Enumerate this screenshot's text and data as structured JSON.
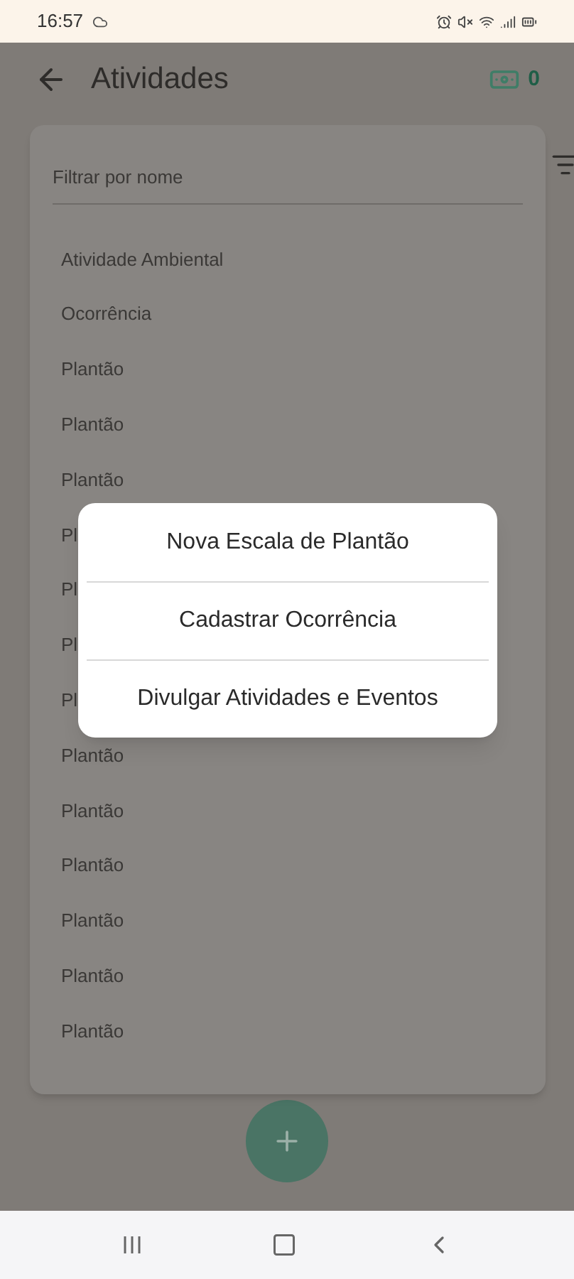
{
  "status_bar": {
    "time": "16:57"
  },
  "app_bar": {
    "title": "Atividades",
    "counter": "0"
  },
  "filter": {
    "placeholder": "Filtrar por nome"
  },
  "items": [
    {
      "label": "Atividade Ambiental"
    },
    {
      "label": "Ocorrência"
    },
    {
      "label": "Plantão"
    },
    {
      "label": "Plantão"
    },
    {
      "label": "Plantão"
    },
    {
      "label": "Pl"
    },
    {
      "label": "Pl"
    },
    {
      "label": "Pl"
    },
    {
      "label": "Pl"
    },
    {
      "label": "Plantão"
    },
    {
      "label": "Plantão"
    },
    {
      "label": "Plantão"
    },
    {
      "label": "Plantão"
    },
    {
      "label": "Plantão"
    },
    {
      "label": "Plantão"
    }
  ],
  "dialog": {
    "options": [
      "Nova Escala de Plantão",
      "Cadastrar Ocorrência",
      "Divulgar Atividades e Eventos"
    ]
  }
}
